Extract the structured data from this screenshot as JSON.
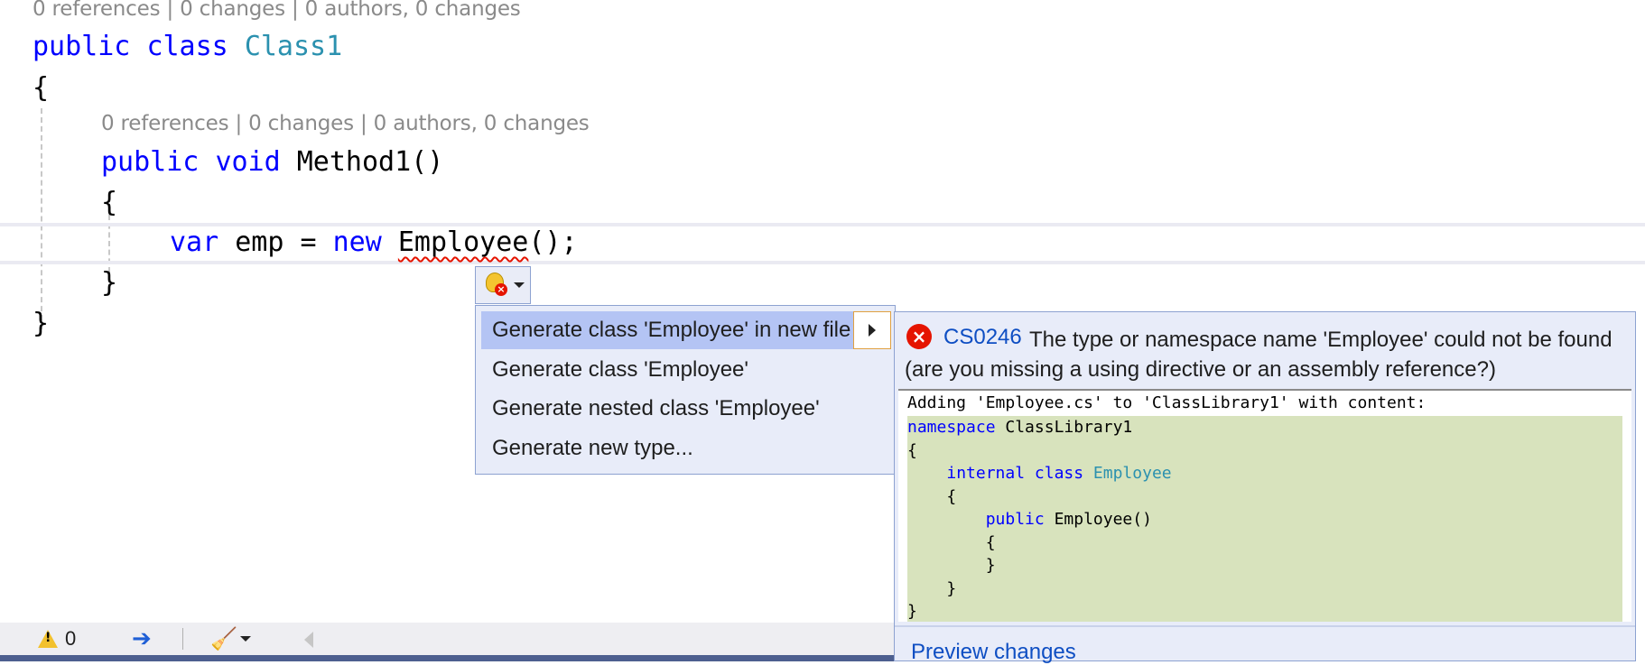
{
  "editor": {
    "class_lens": "0 references | 0 changes | 0 authors, 0 changes",
    "method_lens": "0 references | 0 changes | 0 authors, 0 changes",
    "line_class": {
      "kw1": "public",
      "kw2": "class",
      "name": "Class1"
    },
    "open_brace": "{",
    "close_brace": "}",
    "line_method": {
      "kw1": "public",
      "kw2": "void",
      "name": "Method1()"
    },
    "method_open": "{",
    "method_close": "}",
    "line_var": {
      "kw1": "var",
      "mid": " emp = ",
      "kw2": "new",
      "sp": " ",
      "type_error": "Employee",
      "end": "();"
    }
  },
  "lightbulb": {
    "icon": "lightbulb-error-icon"
  },
  "quick_actions": {
    "items": [
      {
        "label": "Generate class 'Employee' in new file"
      },
      {
        "label": "Generate class 'Employee'"
      },
      {
        "label": "Generate nested class 'Employee'"
      },
      {
        "label": "Generate new type..."
      }
    ]
  },
  "preview": {
    "error_code": "CS0246",
    "error_message": "The type or namespace name 'Employee' could not be found (are you missing a using directive or an assembly reference?)",
    "adding_line": "Adding 'Employee.cs' to 'ClassLibrary1' with content:",
    "code": {
      "ns_kw": "namespace",
      "ns_name": " ClassLibrary1",
      "l2": "{",
      "l3_kw": "internal class",
      "l3_type": "Employee",
      "l4": "    {",
      "l5_kw": "public",
      "l5_rest": " Employee()",
      "l6": "        {",
      "l7": "        }",
      "l8": "    }",
      "l9": "}"
    },
    "link": "Preview changes"
  },
  "status_bar": {
    "warnings": "0"
  },
  "colors": {
    "keyword": "#0000ff",
    "type": "#2b91af",
    "error": "#e51400",
    "link": "#0e4ec3",
    "added_background": "#d8e3bd"
  }
}
